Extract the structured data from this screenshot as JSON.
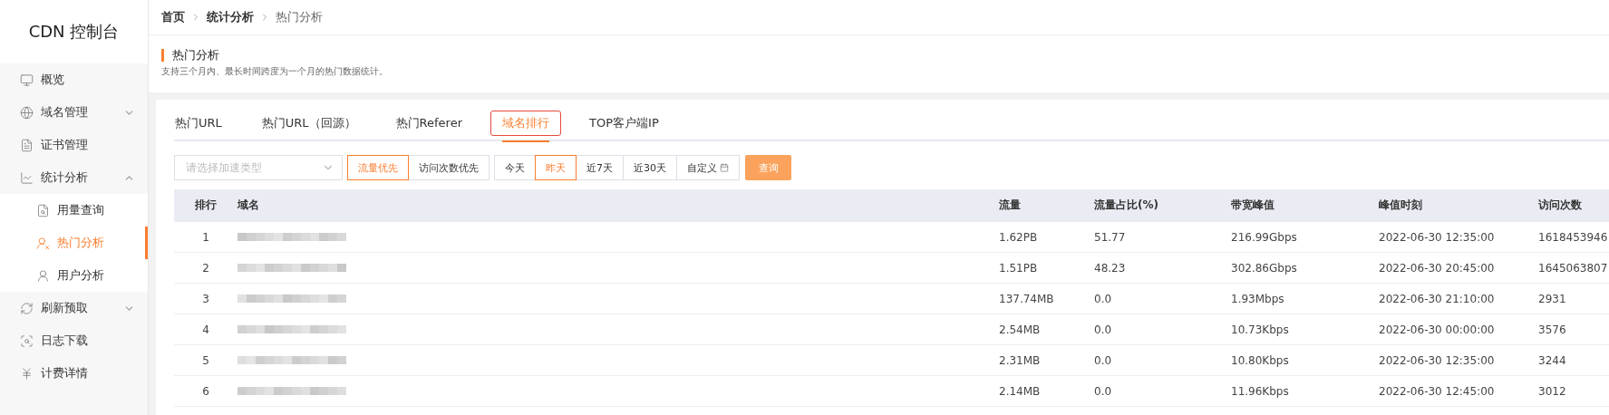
{
  "sidebar": {
    "title": "CDN 控制台",
    "items": [
      {
        "label": "概览",
        "selected": false
      },
      {
        "label": "域名管理",
        "selected": false,
        "expanded": false
      },
      {
        "label": "证书管理",
        "selected": false
      },
      {
        "label": "统计分析",
        "selected": false,
        "expanded": true,
        "children": [
          {
            "label": "用量查询",
            "selected": false
          },
          {
            "label": "热门分析",
            "selected": true
          },
          {
            "label": "用户分析",
            "selected": false
          }
        ]
      },
      {
        "label": "刷新预取",
        "selected": false,
        "expanded": false
      },
      {
        "label": "日志下载",
        "selected": false
      },
      {
        "label": "计费详情",
        "selected": false
      }
    ]
  },
  "breadcrumb": [
    "首页",
    "统计分析",
    "热门分析"
  ],
  "page_header": {
    "title": "热门分析",
    "description": "支持三个月内、最长时间跨度为一个月的热门数据统计。"
  },
  "tabs": [
    {
      "label": "热门URL",
      "selected": false
    },
    {
      "label": "热门URL（回源）",
      "selected": false
    },
    {
      "label": "热门Referer",
      "selected": false
    },
    {
      "label": "域名排行",
      "selected": true
    },
    {
      "label": "TOP客户端IP",
      "selected": false
    }
  ],
  "filters": {
    "type_select": {
      "placeholder": "请选择加速类型"
    },
    "sort_buttons": [
      {
        "label": "流量优先",
        "selected": true
      },
      {
        "label": "访问次数优先",
        "selected": false
      }
    ],
    "date_buttons": [
      {
        "label": "今天",
        "selected": false,
        "kind": "preset"
      },
      {
        "label": "昨天",
        "selected": true,
        "kind": "preset"
      },
      {
        "label": "近7天",
        "selected": false,
        "kind": "preset"
      },
      {
        "label": "近30天",
        "selected": false,
        "kind": "preset"
      },
      {
        "label": "自定义",
        "selected": false,
        "kind": "custom"
      }
    ],
    "query_button": "查询"
  },
  "table": {
    "columns": [
      "排行",
      "域名",
      "流量",
      "流量占比(%)",
      "带宽峰值",
      "峰值时刻",
      "访问次数"
    ],
    "rows": [
      {
        "rank": "1",
        "traffic": "1.62PB",
        "share": "51.77",
        "bandwidth_peak": "216.99Gbps",
        "peak_time": "2022-06-30 12:35:00",
        "visits": "1618453946"
      },
      {
        "rank": "2",
        "traffic": "1.51PB",
        "share": "48.23",
        "bandwidth_peak": "302.86Gbps",
        "peak_time": "2022-06-30 20:45:00",
        "visits": "1645063807"
      },
      {
        "rank": "3",
        "traffic": "137.74MB",
        "share": "0.0",
        "bandwidth_peak": "1.93Mbps",
        "peak_time": "2022-06-30 21:10:00",
        "visits": "2931"
      },
      {
        "rank": "4",
        "traffic": "2.54MB",
        "share": "0.0",
        "bandwidth_peak": "10.73Kbps",
        "peak_time": "2022-06-30 00:00:00",
        "visits": "3576"
      },
      {
        "rank": "5",
        "traffic": "2.31MB",
        "share": "0.0",
        "bandwidth_peak": "10.80Kbps",
        "peak_time": "2022-06-30 12:35:00",
        "visits": "3244"
      },
      {
        "rank": "6",
        "traffic": "2.14MB",
        "share": "0.0",
        "bandwidth_peak": "11.96Kbps",
        "peak_time": "2022-06-30 12:45:00",
        "visits": "3012"
      }
    ]
  }
}
